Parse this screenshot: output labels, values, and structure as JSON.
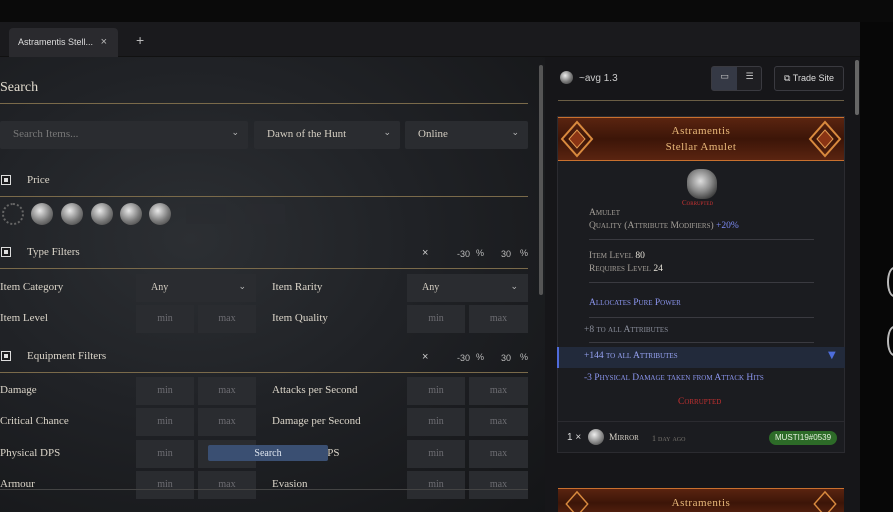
{
  "tab": {
    "label": "Astramentis Stell...",
    "close": "×",
    "add": "+"
  },
  "search": {
    "heading": "Search",
    "placeholder": "Search Items...",
    "league": "Dawn of the Hunt",
    "status": "Online",
    "submit": "Search"
  },
  "price": {
    "title": "Price"
  },
  "type_filters": {
    "title": "Type Filters",
    "x": "×",
    "min_pct": "-30",
    "max_pct": "30",
    "pct_sign": "%",
    "item_category_label": "Item Category",
    "item_category_value": "Any",
    "item_rarity_label": "Item Rarity",
    "item_rarity_value": "Any",
    "item_level_label": "Item Level",
    "item_quality_label": "Item Quality"
  },
  "equipment_filters": {
    "title": "Equipment Filters",
    "x": "×",
    "min_pct": "-30",
    "max_pct": "30",
    "pct_sign": "%",
    "rows": [
      {
        "left": "Damage",
        "right": "Attacks per Second"
      },
      {
        "left": "Critical Chance",
        "right": "Damage per Second"
      },
      {
        "left": "Physical DPS",
        "right": "Elemental DPS"
      },
      {
        "left": "Armour",
        "right": "Evasion"
      }
    ]
  },
  "field_placeholders": {
    "min": "min",
    "max": "max"
  },
  "results": {
    "avg": "~avg 1.3",
    "trade_site": "Trade Site",
    "view_grid_icon": "monitor-icon",
    "view_list_icon": "list-icon"
  },
  "item": {
    "name_line1": "Astramentis",
    "name_line2": "Stellar Amulet",
    "icon_tag": "Corrupted",
    "type": "Amulet",
    "quality_label": "Quality (Attribute Modifiers)",
    "quality_value": "+20%",
    "item_level_label": "Item Level",
    "item_level_value": "80",
    "requires_label": "Requires Level",
    "requires_value": "24",
    "granted": "Allocates Pure Power",
    "implicit": "+8 to all Attributes",
    "mod1": "+144 to all Attributes",
    "mod2": "-3 Physical Damage taken from Attack Hits",
    "corrupted": "Corrupted",
    "price_qty": "1 ×",
    "price_currency": "Mirror",
    "listed": "1 day ago",
    "seller": "MUSTI19#0539"
  },
  "next_item": {
    "name_line1": "Astramentis"
  },
  "colors": {
    "accent_blue": "#4f6bdb",
    "magic_mod": "#8b95ee",
    "corrupted_red": "#c23030",
    "unique_name": "#e9b97a",
    "online_badge": "#2d6b28"
  }
}
